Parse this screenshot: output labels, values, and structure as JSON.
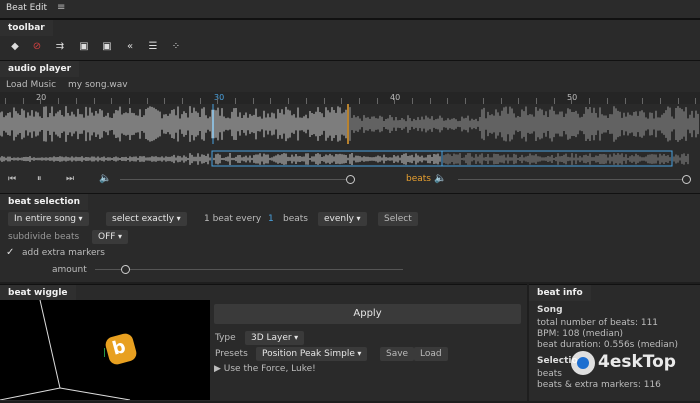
{
  "window": {
    "title": "Beat Edit"
  },
  "toolbar": {
    "label": "toolbar"
  },
  "audio": {
    "label": "audio player",
    "load_music": "Load Music",
    "filename": "my song.wav",
    "ticks": [
      "20",
      "30",
      "40",
      "50"
    ],
    "beats_label": "beats"
  },
  "selection": {
    "label": "beat selection",
    "scope": "In entire song",
    "mode": "select exactly",
    "beat_every_text": "1 beat every",
    "beat_count": "1",
    "beats_text": "beats",
    "distribution": "evenly",
    "select_button": "Select",
    "subdivide_label": "subdivide beats",
    "subdivide_value": "OFF",
    "extra_markers_label": "add extra markers",
    "extra_markers_checked": true,
    "amount_label": "amount"
  },
  "wiggle": {
    "label": "beat wiggle",
    "apply_button": "Apply",
    "type_label": "Type",
    "type_value": "3D Layer",
    "presets_label": "Presets",
    "presets_value": "Position Peak Simple",
    "save_button": "Save",
    "load_button": "Load",
    "force_text": "▶ Use the Force, Luke!"
  },
  "info": {
    "label": "beat info",
    "song_header": "Song",
    "total_beats": "total number of beats: 111",
    "bpm": "BPM: 108 (median)",
    "duration": "beat duration: 0.556s (median)",
    "selection_header": "Selection",
    "beats_line": "beats",
    "beats_extra": "beats & extra markers: 116"
  },
  "watermark": {
    "text": "4eskTop"
  },
  "colors": {
    "accent": "#4aa3e0",
    "highlight": "#e8a030",
    "waveform": "#d0d0d0"
  }
}
